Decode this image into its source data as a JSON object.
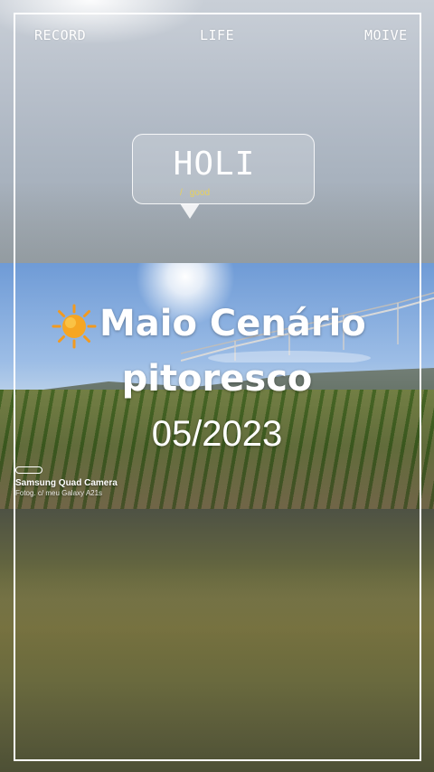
{
  "nav": {
    "record_label": "RECORD",
    "life_label": "LIFE",
    "moive_label": "MOIVE"
  },
  "bubble": {
    "title": "HOLI",
    "subtitle": "good"
  },
  "caption": {
    "line1": "Maio Cenário",
    "line2": "pitoresco",
    "date": "05/2023",
    "emoji": "sun-emoji"
  },
  "watermark": {
    "title": "Samsung Quad Camera",
    "subtitle": "Fotog. c/ meu Galaxy A21s"
  },
  "colors": {
    "frame": "#ffffff",
    "bubble_subtitle": "#e8d15c",
    "sun": "#f4a52a"
  }
}
